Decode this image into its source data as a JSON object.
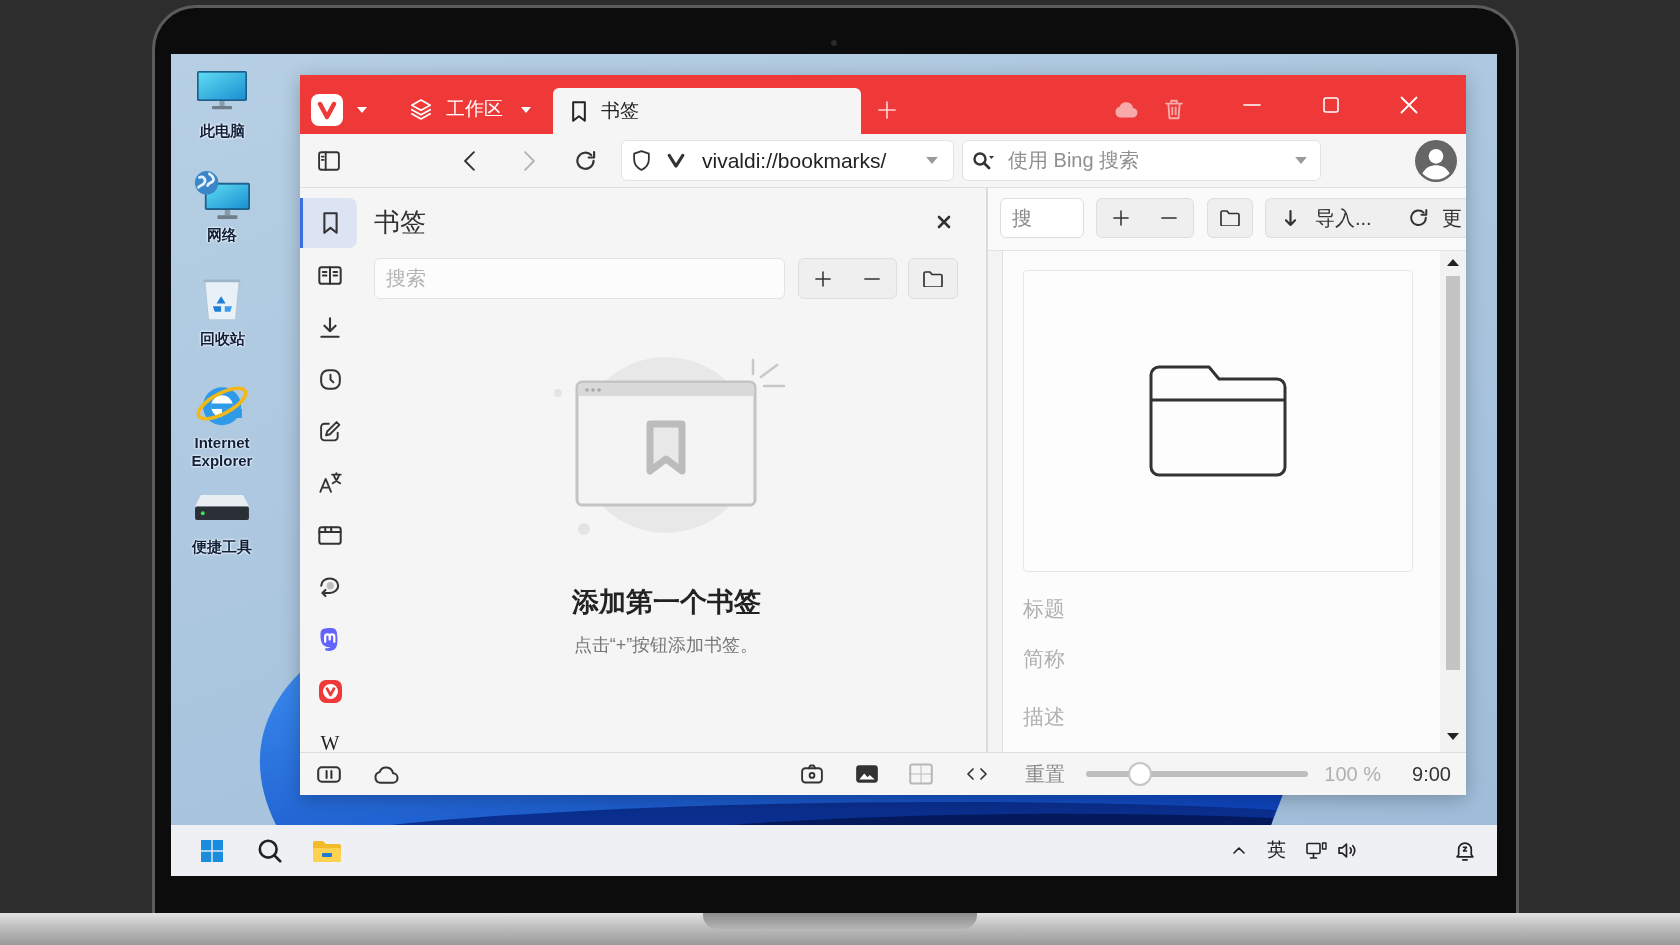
{
  "desktop": {
    "icons": [
      {
        "kind": "computer",
        "label": "此电脑"
      },
      {
        "kind": "network",
        "label": "网络"
      },
      {
        "kind": "recycle_bin",
        "label": "回收站"
      },
      {
        "kind": "browser",
        "label": "Internet Explorer"
      },
      {
        "kind": "drive",
        "label": "便捷工具"
      }
    ]
  },
  "browser": {
    "tab_bar": {
      "workspace": "工作区",
      "tabs": [
        {
          "label": "书签",
          "selected": true
        }
      ]
    },
    "toolbar": {
      "nav_buttons": [
        {
          "kind": "back",
          "disabled": false
        },
        {
          "kind": "forward",
          "disabled": true
        },
        {
          "kind": "reload",
          "disabled": false
        }
      ],
      "address": "vivaldi://bookmarks/",
      "search_placeholder": "使用 Bing 搜索"
    },
    "side_panel": {
      "items": [
        {
          "kind": "bookmarks",
          "selected": true
        },
        {
          "kind": "reading_list",
          "selected": false
        },
        {
          "kind": "downloads",
          "selected": false
        },
        {
          "kind": "history",
          "selected": false
        },
        {
          "kind": "notes",
          "selected": false
        },
        {
          "kind": "translate",
          "selected": false
        },
        {
          "kind": "window",
          "selected": false
        },
        {
          "kind": "feeds",
          "selected": false
        },
        {
          "kind": "mastodon",
          "selected": false
        },
        {
          "kind": "vivaldi",
          "selected": false
        },
        {
          "kind": "wikipedia",
          "selected": false,
          "glyph": "W"
        }
      ]
    },
    "bookmark_panel": {
      "title": "书签",
      "search_placeholder": "搜索",
      "empty_title": "添加第一个书签",
      "empty_hint": "点击“+”按钮添加书签。"
    },
    "bookmark_manager": {
      "search_placeholder": "搜",
      "import_label": "导入...",
      "update_label": "更",
      "detail_fields": [
        {
          "placeholder": "标题"
        },
        {
          "placeholder": "简称"
        },
        {
          "placeholder": "描述"
        }
      ]
    },
    "status_bar": {
      "reset_label": "重置",
      "zoom_slider": {
        "level": 0.21
      },
      "zoom_reading": "100 %",
      "clock": "9:00"
    }
  },
  "taskbar": {
    "input_indicator": "英"
  }
}
